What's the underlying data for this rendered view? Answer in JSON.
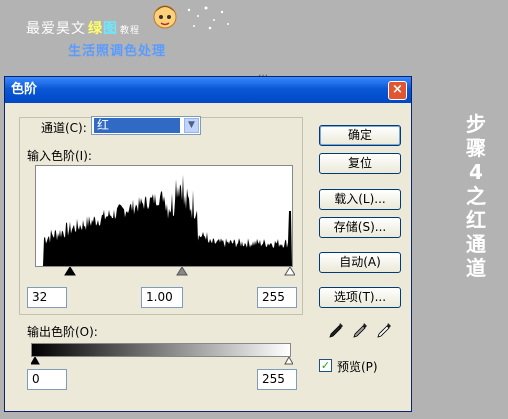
{
  "branding": {
    "line1_prefix": "最爱昊文",
    "line1_hl1": "绿",
    "line1_hl2": "图",
    "line1_suffix": "教程",
    "line2": "生活照调色处理"
  },
  "background_menu": "…",
  "side_caption": [
    "步",
    "骤",
    "4",
    "之",
    "红",
    "通",
    "道"
  ],
  "dialog": {
    "title": "色阶",
    "close_label": "×",
    "channel_label": "通道(C):",
    "channel_value": "红",
    "input_levels_label": "输入色阶(I):",
    "input_values": [
      "32",
      "1.00",
      "255"
    ],
    "output_levels_label": "输出色阶(O):",
    "output_values": [
      "0",
      "255"
    ],
    "buttons": {
      "ok": "确定",
      "reset": "复位",
      "load": "载入(L)...",
      "save": "存储(S)...",
      "auto": "自动(A)",
      "options": "选项(T)..."
    },
    "preview_label": "预览(P)",
    "preview_checked": true
  }
}
